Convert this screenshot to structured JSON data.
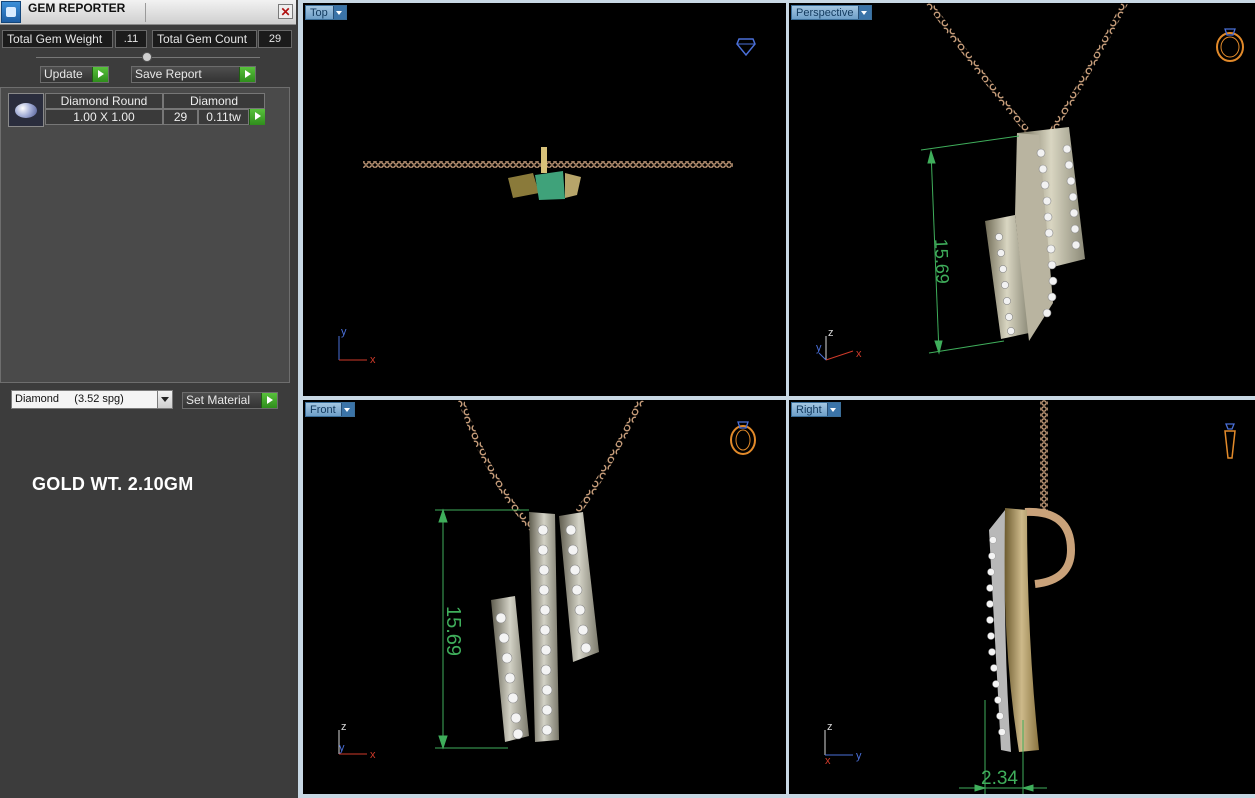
{
  "panel": {
    "title": "GEM REPORTER",
    "close_glyph": "✕",
    "total_weight_label": "Total Gem Weight",
    "total_weight_value": ".11",
    "total_count_label": "Total Gem Count",
    "total_count_value": "29",
    "update_label": "Update",
    "save_report_label": "Save Report"
  },
  "gem_table": {
    "headers": [
      "Diamond Round",
      "Diamond"
    ],
    "row": {
      "size": "1.00 X 1.00",
      "count": "29",
      "weight": "0.11tw"
    }
  },
  "material": {
    "selected": "Diamond     (3.52 spg)",
    "set_label": "Set Material"
  },
  "annotation": {
    "gold_weight": "GOLD WT. 2.10GM"
  },
  "viewports": {
    "top": {
      "label": "Top",
      "axis_y": "y",
      "axis_x": "x"
    },
    "perspective": {
      "label": "Perspective",
      "dimension": "15.69",
      "axis_z": "z",
      "axis_y": "y",
      "axis_x": "x"
    },
    "front": {
      "label": "Front",
      "dimension": "15.69",
      "axis_z": "z",
      "axis_y": "y",
      "axis_x": "x"
    },
    "right": {
      "label": "Right",
      "dimension": "2.34",
      "axis_z": "z",
      "axis_x": "x",
      "axis_y": "y"
    }
  },
  "colors": {
    "gold": "#c9a27a",
    "dimension_green": "#3fae5b",
    "axis_red": "#d03a2a",
    "axis_blue": "#4a6fd8",
    "panel_bg": "#3c3c3c"
  },
  "icons": [
    "app-icon",
    "gem-icon",
    "ring-icon",
    "pendant-icon"
  ]
}
